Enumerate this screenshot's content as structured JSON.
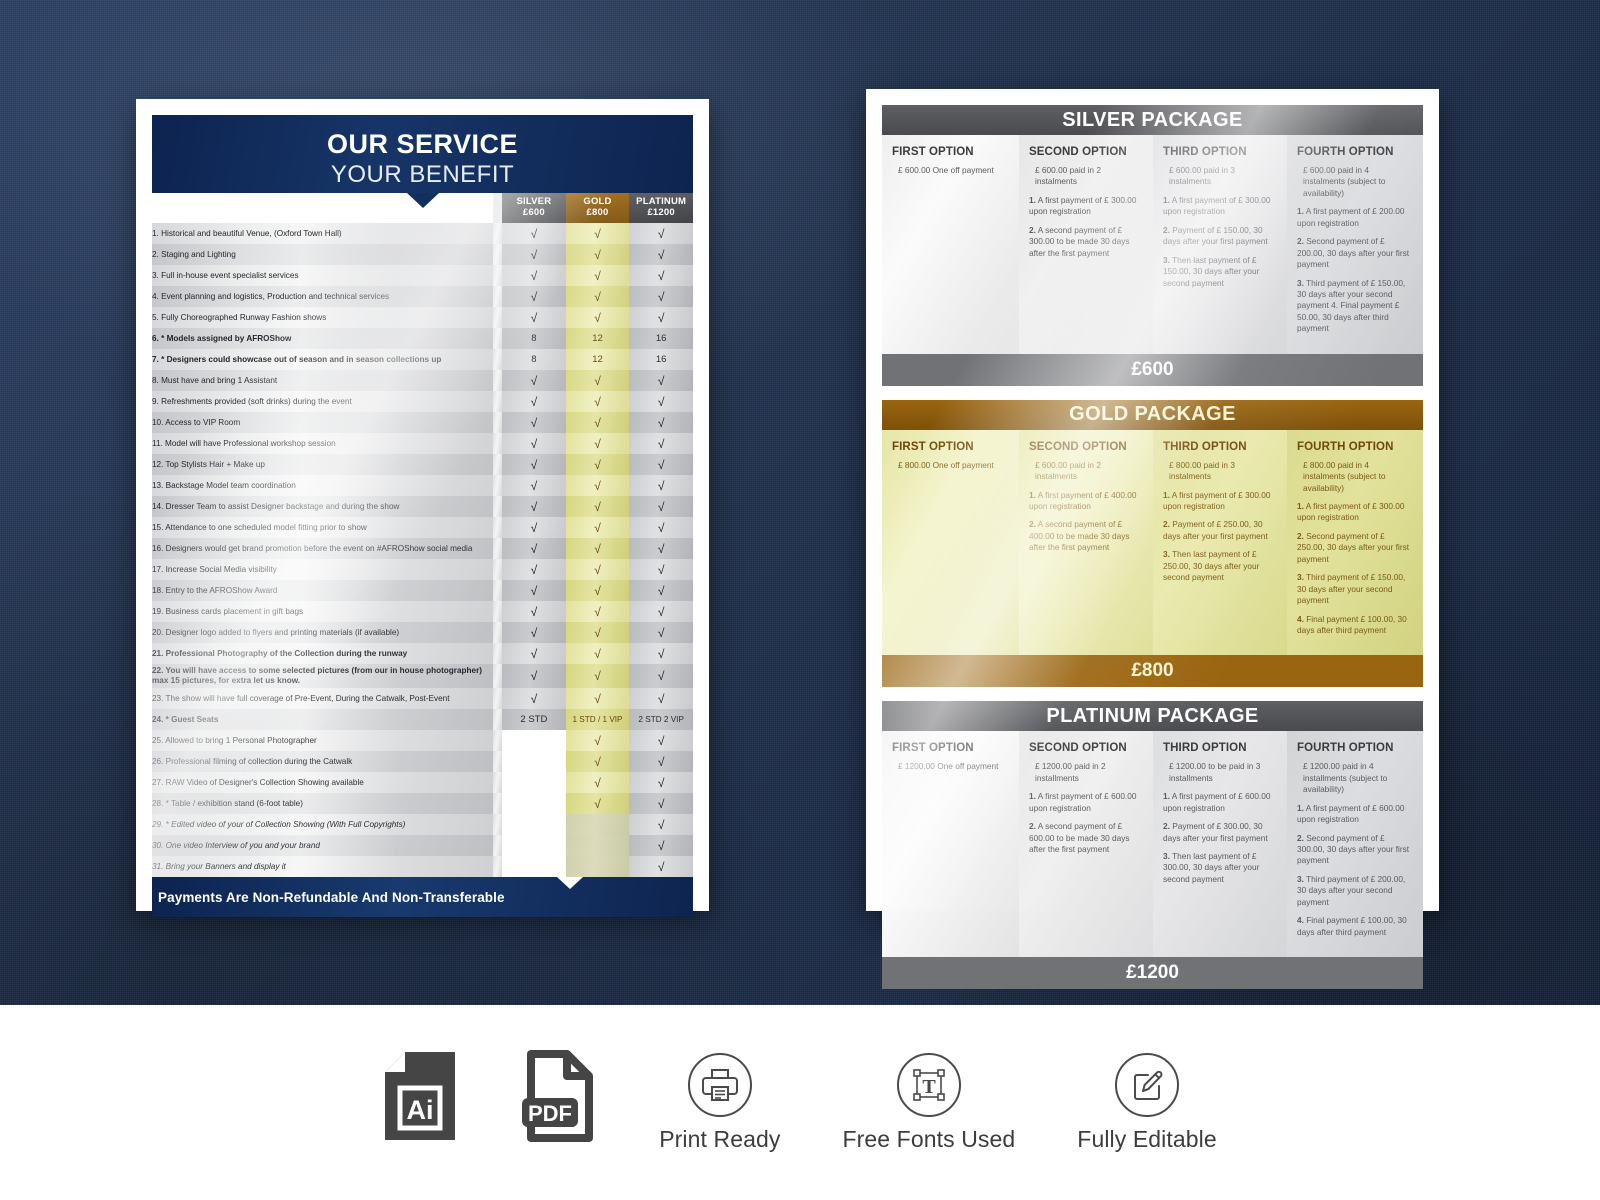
{
  "left_sheet": {
    "header": {
      "line1": "OUR SERVICE",
      "line2": "YOUR BENEFIT"
    },
    "columns": [
      {
        "name": "SILVER",
        "price": "£600"
      },
      {
        "name": "GOLD",
        "price": "£800"
      },
      {
        "name": "PLATINUM",
        "price": "£1200"
      }
    ],
    "check": "√",
    "rows": [
      {
        "n": 1,
        "text": "1. Historical and beautiful Venue, (Oxford Town Hall)",
        "style": "normal",
        "silver": "√",
        "gold": "√",
        "platinum": "√"
      },
      {
        "n": 2,
        "text": "2. Staging and Lighting",
        "style": "normal",
        "silver": "√",
        "gold": "√",
        "platinum": "√"
      },
      {
        "n": 3,
        "text": "3. Full in-house event specialist services",
        "style": "normal",
        "silver": "√",
        "gold": "√",
        "platinum": "√"
      },
      {
        "n": 4,
        "text": "4. Event planning and logistics, Production and technical services",
        "style": "normal",
        "silver": "√",
        "gold": "√",
        "platinum": "√"
      },
      {
        "n": 5,
        "text": "5. Fully Choreographed Runway Fashion shows",
        "style": "normal",
        "silver": "√",
        "gold": "√",
        "platinum": "√"
      },
      {
        "n": 6,
        "text": "6. * Models assigned by AFROShow",
        "style": "bold",
        "silver": "8",
        "gold": "12",
        "platinum": "16"
      },
      {
        "n": 7,
        "text": "7. * Designers could showcase  out of season and in season collections up",
        "style": "bold",
        "silver": "8",
        "gold": "12",
        "platinum": "16"
      },
      {
        "n": 8,
        "text": "8. Must have and bring 1 Assistant",
        "style": "normal",
        "silver": "√",
        "gold": "√",
        "platinum": "√"
      },
      {
        "n": 9,
        "text": "9. Refreshments provided (soft drinks) during the event",
        "style": "normal",
        "silver": "√",
        "gold": "√",
        "platinum": "√"
      },
      {
        "n": 10,
        "text": "10. Access to VIP Room",
        "style": "normal",
        "silver": "√",
        "gold": "√",
        "platinum": "√"
      },
      {
        "n": 11,
        "text": "11. Model will have Professional workshop session",
        "style": "normal",
        "silver": "√",
        "gold": "√",
        "platinum": "√"
      },
      {
        "n": 12,
        "text": "12. Top Stylists Hair + Make up",
        "style": "normal",
        "silver": "√",
        "gold": "√",
        "platinum": "√"
      },
      {
        "n": 13,
        "text": "13.  Backstage Model team coordination",
        "style": "normal",
        "silver": "√",
        "gold": "√",
        "platinum": "√"
      },
      {
        "n": 14,
        "text": "14. Dresser Team to assist Designer backstage and during the show",
        "style": "normal",
        "silver": "√",
        "gold": "√",
        "platinum": "√"
      },
      {
        "n": 15,
        "text": "15. Attendance to one scheduled model fitting prior to show",
        "style": "normal",
        "silver": "√",
        "gold": "√",
        "platinum": "√"
      },
      {
        "n": 16,
        "text": "16. Designers would get brand promotion before the event on #AFROShow social media",
        "style": "normal",
        "silver": "√",
        "gold": "√",
        "platinum": "√"
      },
      {
        "n": 17,
        "text": "17. Increase Social Media visibility",
        "style": "normal",
        "silver": "√",
        "gold": "√",
        "platinum": "√"
      },
      {
        "n": 18,
        "text": "18. Entry to the AFROShow Award",
        "style": "normal",
        "silver": "√",
        "gold": "√",
        "platinum": "√"
      },
      {
        "n": 19,
        "text": "19. Business cards placement in gift bags",
        "style": "normal",
        "silver": "√",
        "gold": "√",
        "platinum": "√"
      },
      {
        "n": 20,
        "text": "20. Designer logo added to flyers and printing materials (if available)",
        "style": "normal",
        "silver": "√",
        "gold": "√",
        "platinum": "√"
      },
      {
        "n": 21,
        "text": "21. Professional Photography  of the Collection during the runway",
        "style": "bold",
        "silver": "√",
        "gold": "√",
        "platinum": "√"
      },
      {
        "n": 22,
        "text": "22. You will have access to some selected pictures (from our in house photographer) max 15 pictures, for extra let us know.",
        "style": "bold",
        "silver": "√",
        "gold": "√",
        "platinum": "√"
      },
      {
        "n": 23,
        "text": "23. The show will have full coverage of Pre-Event, During the Catwalk, Post-Event",
        "style": "normal",
        "silver": "√",
        "gold": "√",
        "platinum": "√"
      },
      {
        "n": 24,
        "text": "24. * Guest Seats",
        "style": "bold",
        "silver": "2 STD",
        "gold": "1 STD / 1 VIP",
        "platinum": "2 STD 2 VIP"
      },
      {
        "n": 25,
        "text": "25. Allowed to bring 1 Personal Photographer",
        "style": "normal",
        "silver": "",
        "gold": "√",
        "platinum": "√"
      },
      {
        "n": 26,
        "text": "26. Professional  filming  of  collection during the Catwalk",
        "style": "normal",
        "silver": "",
        "gold": "√",
        "platinum": "√"
      },
      {
        "n": 27,
        "text": "27. RAW Video of Designer's Collection Showing available",
        "style": "normal",
        "silver": "",
        "gold": "√",
        "platinum": "√"
      },
      {
        "n": 28,
        "text": "28. * Table / exhibition stand (6-foot table)",
        "style": "normal",
        "silver": "",
        "gold": "√",
        "platinum": "√"
      },
      {
        "n": 29,
        "text": "29. * Edited video of your  of Collection Showing (With Full Copyrights)",
        "style": "italic",
        "silver": "",
        "gold": "",
        "platinum": "√"
      },
      {
        "n": 30,
        "text": "30. One video Interview of you and your brand",
        "style": "italic",
        "silver": "",
        "gold": "",
        "platinum": "√"
      },
      {
        "n": 31,
        "text": "31. Bring your Banners and display it",
        "style": "italic",
        "silver": "",
        "gold": "",
        "platinum": "√"
      }
    ],
    "footer": "Payments Are Non-Refundable And Non-Transferable"
  },
  "right_sheet": {
    "packages": [
      {
        "key": "silver",
        "title": "SILVER PACKAGE",
        "price": "£600",
        "options": [
          {
            "head": "FIRST OPTION",
            "lead": "£ 600.00 One off payment",
            "items": []
          },
          {
            "head": "SECOND OPTION",
            "lead": "£ 600.00 paid in 2 instalments",
            "items": [
              {
                "num": "1.",
                "text": " A first payment of £ 300.00 upon registration"
              },
              {
                "num": "2.",
                "text": " A second payment of £ 300.00 to be made 30 days after the first payment"
              }
            ]
          },
          {
            "head": "THIRD OPTION",
            "lead": "£ 600.00 paid in 3 instalments",
            "items": [
              {
                "num": "1.",
                "text": " A first payment of £ 300.00 upon registration"
              },
              {
                "num": "2.",
                "text": " Payment of £ 150.00, 30 days after your first payment"
              },
              {
                "num": "3.",
                "text": " Then last payment of £ 150.00, 30 days after your second payment"
              }
            ]
          },
          {
            "head": "FOURTH OPTION",
            "lead": "£ 600.00 paid in 4 instalments (subject to availability)",
            "items": [
              {
                "num": "1.",
                "text": " A first payment of £ 200.00 upon registration"
              },
              {
                "num": "2.",
                "text": " Second payment of £ 200.00, 30 days after your first payment"
              },
              {
                "num": "3.",
                "text": " Third payment of £ 150.00, 30 days after your second payment 4. Final payment £ 50.00, 30 days after third payment"
              }
            ]
          }
        ]
      },
      {
        "key": "gold",
        "title": "GOLD PACKAGE",
        "price": "£800",
        "options": [
          {
            "head": "FIRST OPTION",
            "lead": "£ 800.00 One off payment",
            "items": []
          },
          {
            "head": "SECOND OPTION",
            "lead": "£ 600.00 paid in 2 instalments",
            "items": [
              {
                "num": "1.",
                "text": " A first payment of £ 400.00 upon registration"
              },
              {
                "num": "2.",
                "text": " A second payment of £ 400.00 to be made 30 days after the first payment"
              }
            ]
          },
          {
            "head": "THIRD OPTION",
            "lead": "£ 800.00 paid in 3 instalments",
            "items": [
              {
                "num": "1.",
                "text": " A first payment of £ 300.00 upon registration"
              },
              {
                "num": "2.",
                "text": " Payment of £ 250.00, 30 days after your first payment"
              },
              {
                "num": "3.",
                "text": " Then last payment of £ 250.00, 30 days after your second payment"
              }
            ]
          },
          {
            "head": "FOURTH OPTION",
            "lead": "£ 800.00 paid in 4 instalments (subject to availability)",
            "items": [
              {
                "num": "1.",
                "text": " A first payment of £ 300.00 upon registration"
              },
              {
                "num": "2.",
                "text": " Second payment of £ 250.00, 30 days after your first payment"
              },
              {
                "num": "3.",
                "text": " Third payment of £ 150.00, 30 days after your second payment"
              },
              {
                "num": "4.",
                "text": " Final payment £ 100.00, 30 days after third payment"
              }
            ]
          }
        ]
      },
      {
        "key": "platinum",
        "title": "PLATINUM PACKAGE",
        "price": "£1200",
        "options": [
          {
            "head": "FIRST OPTION",
            "lead": "£ 1200.00 One off payment",
            "items": []
          },
          {
            "head": "SECOND OPTION",
            "lead": "£ 1200.00 paid in 2 installments",
            "items": [
              {
                "num": "1.",
                "text": " A first payment of £ 600.00 upon registration"
              },
              {
                "num": "2.",
                "text": " A second payment of £ 600.00 to be made 30 days after the first payment"
              }
            ]
          },
          {
            "head": "THIRD OPTION",
            "lead": "£ 1200.00 to be paid in 3 installments",
            "items": [
              {
                "num": "1.",
                "text": " A first payment of £ 600.00 upon registration"
              },
              {
                "num": "2.",
                "text": " Payment of £ 300.00, 30 days after your first payment"
              },
              {
                "num": "3.",
                "text": " Then last payment of £ 300.00, 30 days after your second payment"
              }
            ]
          },
          {
            "head": "FOURTH OPTION",
            "lead": "£ 1200.00 paid in 4 installments (subject to availability)",
            "items": [
              {
                "num": "1.",
                "text": " A first payment of £ 600.00 upon registration"
              },
              {
                "num": "2.",
                "text": " Second payment of £ 300.00, 30 days after your first payment"
              },
              {
                "num": "3.",
                "text": " Third payment of £ 200.00, 30 days after your second payment"
              },
              {
                "num": "4.",
                "text": " Final payment £ 100.00, 30 days after third payment"
              }
            ]
          }
        ]
      }
    ]
  },
  "bottom_bar": {
    "badges": [
      {
        "icon": "ai-file-icon",
        "label": "",
        "glyph": "Ai"
      },
      {
        "icon": "pdf-file-icon",
        "label": "",
        "glyph": "PDF"
      },
      {
        "icon": "printer-icon",
        "label": "Print Ready",
        "glyph": ""
      },
      {
        "icon": "text-frame-icon",
        "label": "Free Fonts Used",
        "glyph": ""
      },
      {
        "icon": "pencil-square-icon",
        "label": "Fully Editable",
        "glyph": ""
      }
    ]
  },
  "colors": {
    "navy_header": "#12305e",
    "gold": "#9a6510",
    "silver_gray": "#4a4b4f",
    "gold_fill": "#e6e6a8",
    "backdrop": "#233553"
  }
}
